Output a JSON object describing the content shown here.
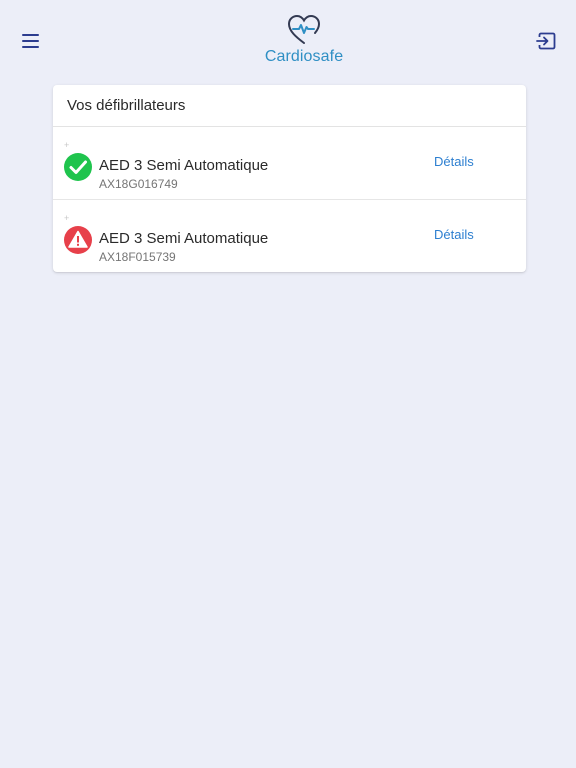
{
  "header": {
    "menu_icon": "hamburger-menu-icon",
    "logo_icon": "heart-pulse-icon",
    "logo_text": "Cardiosafe",
    "logout_icon": "logout-icon",
    "colors": {
      "nav": "#2c3c8f",
      "logo_text": "#2f8fc4"
    }
  },
  "card": {
    "title": "Vos défibrillateurs",
    "devices": [
      {
        "name": "AED 3 Semi Automatique",
        "serial": "AX18G016749",
        "status": "ok",
        "status_icon": "check-circle-icon",
        "status_color": "#1fc44d",
        "details_label": "Détails"
      },
      {
        "name": "AED 3 Semi Automatique",
        "serial": "AX18F015739",
        "status": "warning",
        "status_icon": "warning-circle-icon",
        "status_color": "#e7404a",
        "details_label": "Détails"
      }
    ]
  },
  "colors": {
    "background": "#eceef8",
    "link": "#2d7fd0"
  }
}
